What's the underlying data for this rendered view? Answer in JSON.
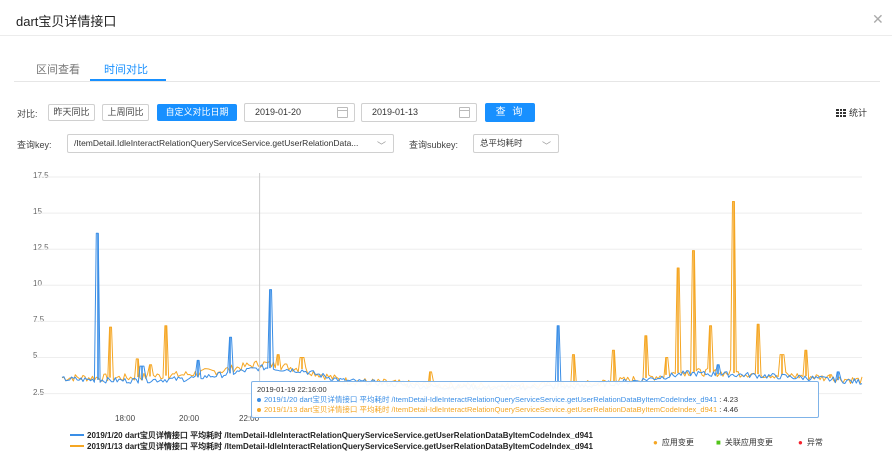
{
  "dialog": {
    "title": "dart宝贝详情接口",
    "close_icon": "close-icon"
  },
  "tabs": [
    {
      "label": "区间查看",
      "active": false
    },
    {
      "label": "时间对比",
      "active": true
    }
  ],
  "toolbar": {
    "compare_label": "对比:",
    "buttons": [
      {
        "label": "昨天同比",
        "active": false
      },
      {
        "label": "上周同比",
        "active": false
      },
      {
        "label": "自定义对比日期",
        "active": true
      }
    ],
    "date1": "2019-01-20",
    "date2": "2019-01-13",
    "query_label": "查 询",
    "stats_label": "统计",
    "stats_icon": "table-grid-icon"
  },
  "filters": {
    "key_label": "查询key:",
    "key_value": "/ItemDetail.IdleInteractRelationQueryServiceService.getUserRelationData...",
    "subkey_label": "查询subkey:",
    "subkey_value": "总平均耗时"
  },
  "colors": {
    "accent": "#1890ff",
    "series_1": "#3a8ee6",
    "series_2": "#f5a623",
    "app_change": "#f5a623",
    "related_change": "#52c41a",
    "anomaly": "#f5222d"
  },
  "chart_data": {
    "type": "line",
    "y_ticks": [
      "17.5",
      "15",
      "12.5",
      "10",
      "7.5",
      "5",
      "2.5"
    ],
    "ylim": [
      1.5,
      17.5
    ],
    "x_ticks": [
      "18:00",
      "20:00",
      "22:00"
    ],
    "grid": true,
    "legend_position": "bottom",
    "series": [
      {
        "name": "2019/1/20 dart宝贝详情接口 平均耗时 /ItemDetail-IdleInteractRelationQueryServiceService.getUserRelationDataByItemCodeIndex_d941",
        "color": "#3a8ee6",
        "baseline": [
          [
            0,
            3.5
          ],
          [
            0.08,
            3.4
          ],
          [
            0.15,
            3.5
          ],
          [
            0.2,
            3.8
          ],
          [
            0.25,
            4.3
          ],
          [
            0.3,
            4.1
          ],
          [
            0.35,
            3.4
          ],
          [
            0.45,
            3.0
          ],
          [
            0.55,
            2.9
          ],
          [
            0.65,
            3.0
          ],
          [
            0.72,
            3.4
          ],
          [
            0.78,
            3.9
          ],
          [
            0.85,
            3.8
          ],
          [
            0.93,
            3.6
          ],
          [
            1.0,
            3.3
          ]
        ],
        "spikes": [
          [
            0.045,
            13.6
          ],
          [
            0.1,
            4.4
          ],
          [
            0.17,
            4.8
          ],
          [
            0.21,
            6.4
          ],
          [
            0.26,
            9.7
          ],
          [
            0.62,
            7.2
          ],
          [
            0.82,
            4.5
          ],
          [
            0.97,
            4.0
          ]
        ]
      },
      {
        "name": "2019/1/13 dart宝贝详情接口 平均耗时 /ItemDetail-IdleInteractRelationQueryServiceService.getUserRelationDataByItemCodeIndex_d941",
        "color": "#f5a623",
        "baseline": [
          [
            0,
            3.6
          ],
          [
            0.08,
            3.6
          ],
          [
            0.15,
            3.8
          ],
          [
            0.2,
            4.1
          ],
          [
            0.25,
            4.6
          ],
          [
            0.3,
            4.2
          ],
          [
            0.35,
            3.4
          ],
          [
            0.45,
            3.1
          ],
          [
            0.55,
            3.0
          ],
          [
            0.65,
            3.1
          ],
          [
            0.72,
            3.5
          ],
          [
            0.78,
            4.0
          ],
          [
            0.85,
            3.9
          ],
          [
            0.93,
            3.7
          ],
          [
            1.0,
            3.4
          ]
        ],
        "spikes": [
          [
            0.06,
            7.1
          ],
          [
            0.095,
            4.9
          ],
          [
            0.11,
            4.5
          ],
          [
            0.13,
            7.2
          ],
          [
            0.27,
            5.2
          ],
          [
            0.3,
            5.0
          ],
          [
            0.46,
            4.0
          ],
          [
            0.64,
            5.2
          ],
          [
            0.69,
            5.5
          ],
          [
            0.73,
            6.5
          ],
          [
            0.755,
            5.0
          ],
          [
            0.77,
            11.2
          ],
          [
            0.79,
            12.4
          ],
          [
            0.81,
            7.2
          ],
          [
            0.84,
            15.8
          ],
          [
            0.87,
            7.3
          ],
          [
            0.9,
            5.2
          ],
          [
            0.93,
            5.5
          ],
          [
            0.96,
            3.8
          ]
        ]
      }
    ],
    "crosshair_x": 0.247,
    "tooltip": {
      "time": "2019-01-19 22:16:00",
      "rows": [
        {
          "text": "2019/1/20 dart宝贝详情接口 平均耗时 /ItemDetail-IdleInteractRelationQueryServiceService.getUserRelationDataByItemCodeIndex_d941",
          "value": "4.23",
          "color": "#3a8ee6"
        },
        {
          "text": "2019/1/13 dart宝贝详情接口 平均耗时 /ItemDetail-IdleInteractRelationQueryServiceService.getUserRelationDataByItemCodeIndex_d941",
          "value": "4.46",
          "color": "#f5a623"
        }
      ]
    },
    "legend_extra": [
      {
        "label": "应用变更",
        "color": "#f5a623",
        "shape": "dot"
      },
      {
        "label": "关联应用变更",
        "color": "#52c41a",
        "shape": "square"
      },
      {
        "label": "异常",
        "color": "#f5222d",
        "shape": "dot"
      }
    ]
  }
}
